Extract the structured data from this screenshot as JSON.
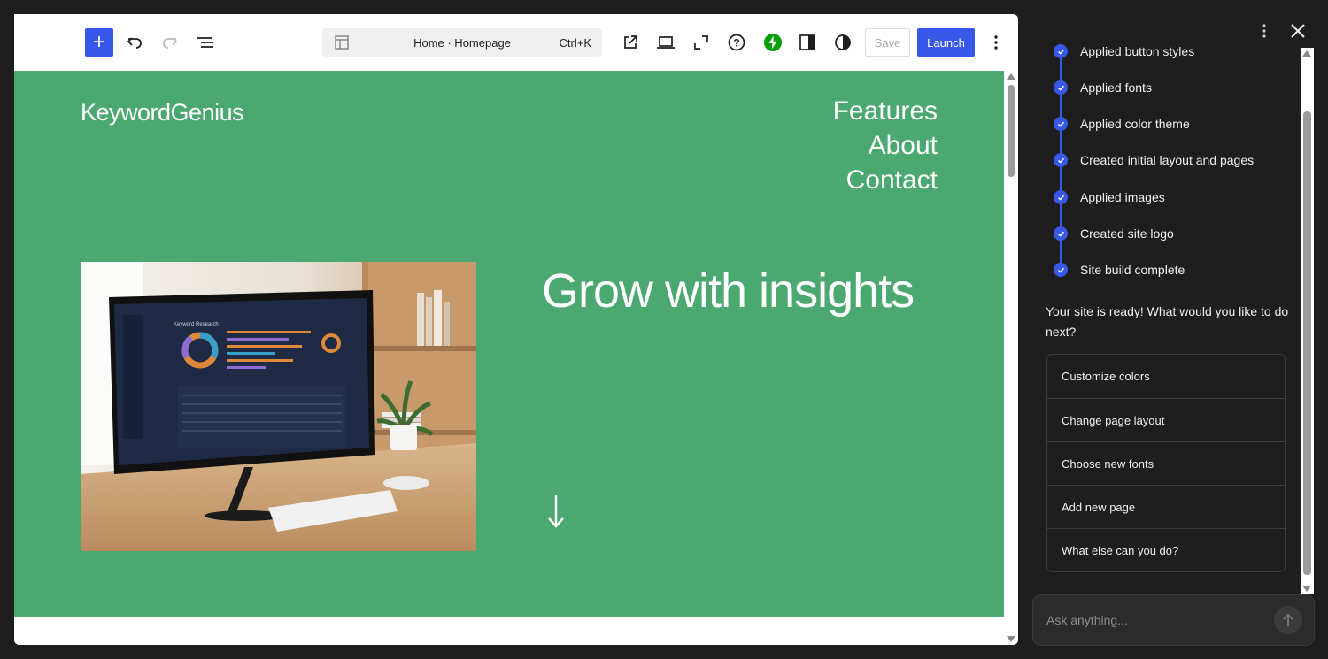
{
  "editor": {
    "command_bar": {
      "title": "Home · Homepage",
      "shortcut": "Ctrl+K"
    },
    "save_label": "Save",
    "launch_label": "Launch",
    "accent_color": "#3858e9"
  },
  "site": {
    "title": "KeywordGenius",
    "nav": [
      "Features",
      "About",
      "Contact"
    ],
    "headline": "Grow with insights",
    "background_color": "#4aa870"
  },
  "hero_image": {
    "screen_title": "Keyword Research"
  },
  "panel": {
    "steps": [
      "Applied button styles",
      "Applied fonts",
      "Applied color theme",
      "Created initial layout and pages",
      "Applied images",
      "Created site logo",
      "Site build complete"
    ],
    "ready_message": "Your site is ready! What would you like to do next?",
    "options": [
      "Customize colors",
      "Change page layout",
      "Choose new fonts",
      "Add new page",
      "What else can you do?"
    ],
    "input_placeholder": "Ask anything..."
  }
}
